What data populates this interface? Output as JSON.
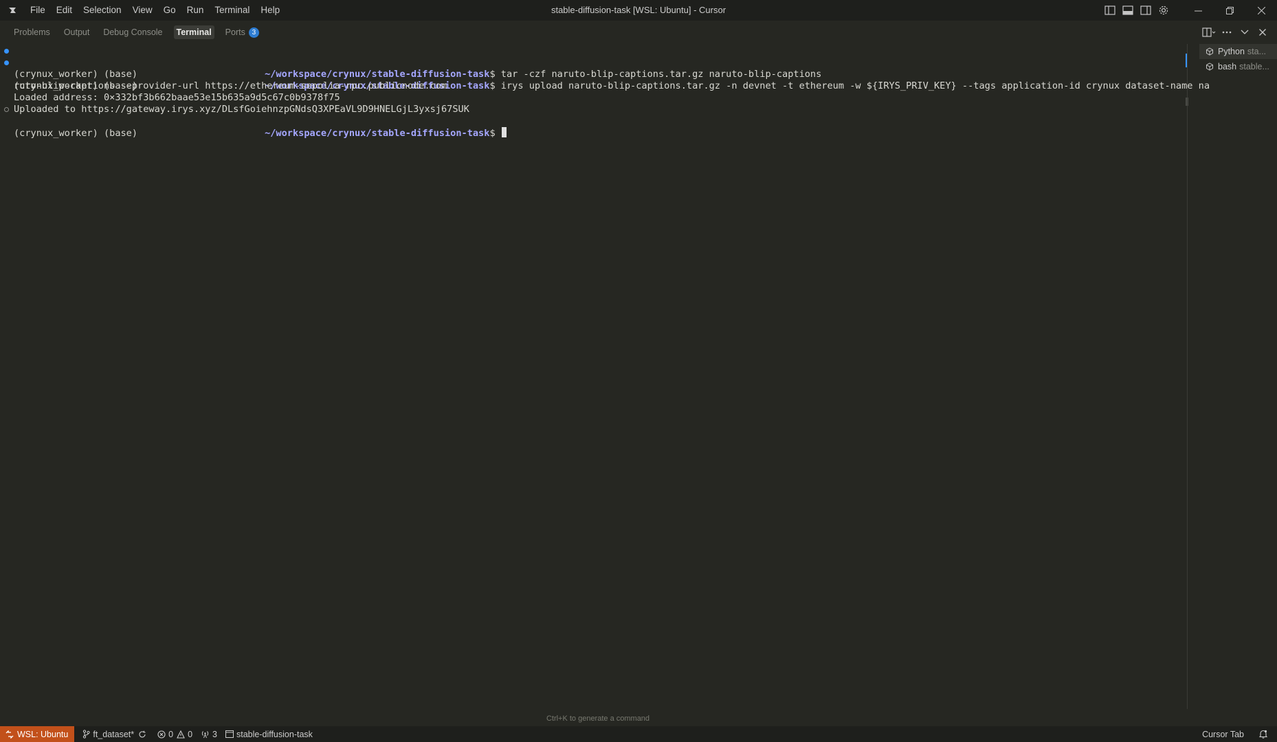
{
  "titlebar": {
    "menu": [
      "File",
      "Edit",
      "Selection",
      "View",
      "Go",
      "Run",
      "Terminal",
      "Help"
    ],
    "title": "stable-diffusion-task [WSL: Ubuntu] - Cursor"
  },
  "panel": {
    "tabs": [
      "Problems",
      "Output",
      "Debug Console",
      "Terminal",
      "Ports"
    ],
    "active_tab": "Terminal",
    "ports_count": "3"
  },
  "terminal": {
    "prompt_env": "(crynux_worker) (base)",
    "cwd": "~/workspace/crynux/stable-diffusion-task",
    "prompt_symbol": "$",
    "cmd1": " tar -czf naruto-blip-captions.tar.gz naruto-blip-captions",
    "cmd2": " irys upload naruto-blip-captions.tar.gz -n devnet -t ethereum -w ${IRYS_PRIV_KEY} --tags application-id crynux dataset-name na",
    "cmd2_wrap": "ruto-blip-captions --provider-url https://ethereum-sepolia-rpc.publicnode.com",
    "out1": "Loaded address: 0×332bf3b662baae53e15b635a9d5c67c0b9378f75",
    "out2": "Uploaded to https://gateway.irys.xyz/DLsfGoiehnzpGNdsQ3XPEaVL9D9HNELGjL3yxsj67SUK",
    "hint": "Ctrl+K to generate a command"
  },
  "terminal_list": [
    {
      "name": "Python",
      "detail": "sta..."
    },
    {
      "name": "bash",
      "detail": "stable..."
    }
  ],
  "statusbar": {
    "remote": "WSL: Ubuntu",
    "branch": "ft_dataset*",
    "errors": "0",
    "warnings": "0",
    "ports": "3",
    "folder": "stable-diffusion-task",
    "cursor_tab": "Cursor Tab"
  },
  "colors": {
    "background": "#262722",
    "cwd": "#a5a7ff",
    "remote": "#c2501a",
    "accent": "#3794ff"
  }
}
